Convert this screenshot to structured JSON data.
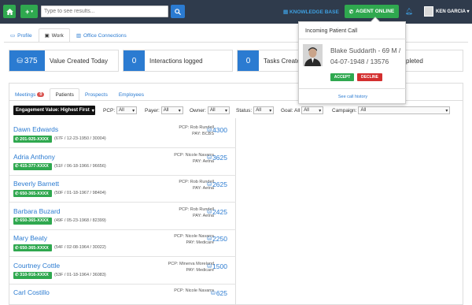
{
  "topbar": {
    "search_placeholder": "Type to see results...",
    "knowledge_base": "KNOWLEDGE BASE",
    "agent_status": "AGENT ONLINE",
    "user_name": "KEN GARCIA"
  },
  "main_tabs": [
    {
      "label": "Profile",
      "icon": "id-card-icon"
    },
    {
      "label": "Work",
      "icon": "briefcase-icon"
    },
    {
      "label": "Office Connections",
      "icon": "building-icon"
    }
  ],
  "stats": [
    {
      "value": "375",
      "label": "Value Created Today",
      "icon": "dollar-icon"
    },
    {
      "value": "0",
      "label": "Interactions logged"
    },
    {
      "value": "0",
      "label": "Tasks Created"
    },
    {
      "label": "pleted"
    }
  ],
  "sub_tabs": [
    {
      "label": "Meetings",
      "badge": "0"
    },
    {
      "label": "Patients"
    },
    {
      "label": "Prospects"
    },
    {
      "label": "Employees"
    }
  ],
  "filters": {
    "sort_label": "Engagement Value: Highest First",
    "pcp_label": "PCP:",
    "pcp_value": "All",
    "payer_label": "Payer:",
    "payer_value": "All",
    "owner_label": "Owner:",
    "owner_value": "All",
    "status_label": "Status:",
    "status_value": "All",
    "goal_label": "Goal: All",
    "goal_value": "All",
    "campaign_label": "Campaign:",
    "campaign_value": "All"
  },
  "patients": [
    {
      "name": "Dawn Edwards",
      "phone": "201-925-XXXX",
      "info": "(67F / 12-23-1950 / 30004)",
      "pcp": "PCP: Rob Rundell",
      "pay": "PAY: BCBS",
      "score": "4300"
    },
    {
      "name": "Adria Anthony",
      "phone": "415-377-XXXX",
      "info": "(51F / 06-18-1966 / 96656)",
      "pcp": "PCP: Nicole Navarra",
      "pay": "PAY: Aetna",
      "score": "3625"
    },
    {
      "name": "Beverly Barnett",
      "phone": "650-365-XXXX",
      "info": "(50F / 01-18-1967 / 98404)",
      "pcp": "PCP: Rob Rundell",
      "pay": "PAY: Aetna",
      "score": "2625"
    },
    {
      "name": "Barbara Buzard",
      "phone": "650-365-XXXX",
      "info": "(49F / 05-23-1968 / 82399)",
      "pcp": "PCP: Rob Rundell",
      "pay": "PAY: Aetna",
      "score": "2425"
    },
    {
      "name": "Mary Beaty",
      "phone": "650-365-XXXX",
      "info": "(54F / 02-08-1964 / 30022)",
      "pcp": "PCP: Nicole Navarra",
      "pay": "PAY: Medicare",
      "score": "2250"
    },
    {
      "name": "Courtney Cottle",
      "phone": "310-916-XXXX",
      "info": "(53F / 01-18-1964 / 36083)",
      "pcp": "PCP: Minerva Moreland",
      "pay": "PAY: Medicare",
      "score": "1500"
    },
    {
      "name": "Carl Costillo",
      "phone": "",
      "info": "",
      "pcp": "PCP: Nicole Navarra",
      "pay": "",
      "score": "625"
    }
  ],
  "call_popup": {
    "title": "Incoming Patient Call",
    "caller": "Blake Suddarth - 69 M / 04-07-1948 / 13576",
    "accept": "ACCEPT",
    "decline": "DECLINE",
    "history": "See call history"
  },
  "colors": {
    "topbar": "#2f3b4c",
    "green": "#2fa84f",
    "blue": "#2b7bd1",
    "red": "#d32f2f"
  }
}
